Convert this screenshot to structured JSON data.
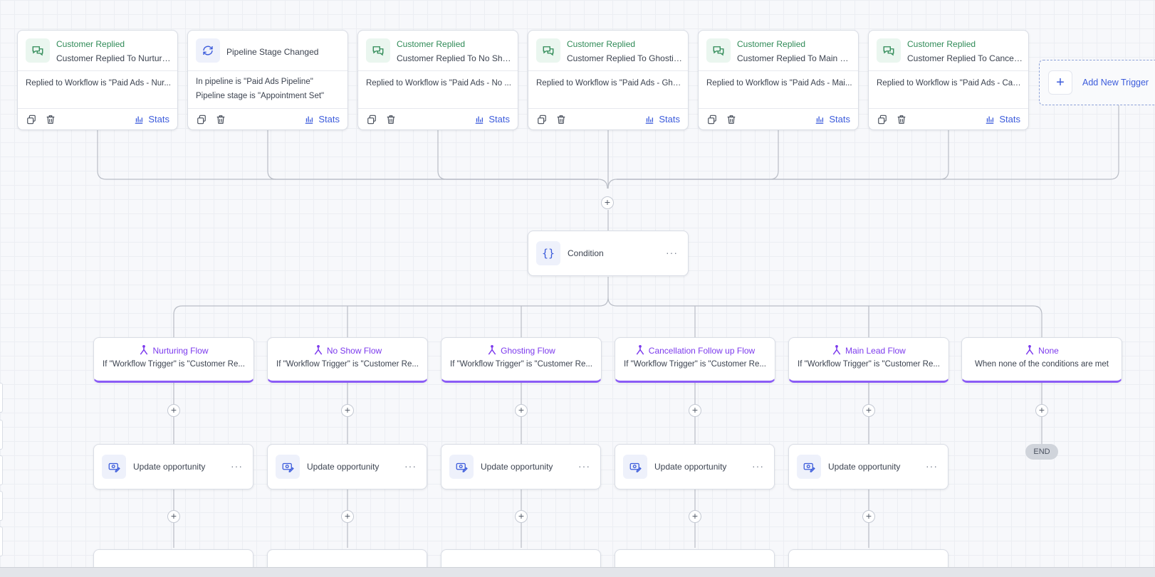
{
  "triggers": [
    {
      "title": "Customer Replied",
      "subtitle": "Customer Replied To Nurturin...",
      "line1": "Replied to Workflow is \"Paid Ads - Nur...",
      "line2": "",
      "icon": "chat-bubbles-icon",
      "stats_label": "Stats"
    },
    {
      "title": "",
      "subtitle": "Pipeline Stage Changed",
      "line1": "In pipeline is \"Paid Ads Pipeline\"",
      "line2": "Pipeline stage is \"Appointment Set\"",
      "icon": "refresh-icon",
      "stats_label": "Stats"
    },
    {
      "title": "Customer Replied",
      "subtitle": "Customer Replied To No Sho...",
      "line1": "Replied to Workflow is \"Paid Ads - No ...",
      "line2": "",
      "icon": "chat-bubbles-icon",
      "stats_label": "Stats"
    },
    {
      "title": "Customer Replied",
      "subtitle": "Customer Replied To Ghostin...",
      "line1": "Replied to Workflow is \"Paid Ads - Gho...",
      "line2": "",
      "icon": "chat-bubbles-icon",
      "stats_label": "Stats"
    },
    {
      "title": "Customer Replied",
      "subtitle": "Customer Replied To Main Le...",
      "line1": "Replied to Workflow is \"Paid Ads - Mai...",
      "line2": "",
      "icon": "chat-bubbles-icon",
      "stats_label": "Stats"
    },
    {
      "title": "Customer Replied",
      "subtitle": "Customer Replied To Cancella...",
      "line1": "Replied to Workflow is \"Paid Ads - Can...",
      "line2": "",
      "icon": "chat-bubbles-icon",
      "stats_label": "Stats"
    }
  ],
  "add_trigger": {
    "label": "Add New Trigger",
    "icon": "plus-icon"
  },
  "condition": {
    "label": "Condition",
    "icon": "braces-icon"
  },
  "branches": [
    {
      "title": "Nurturing Flow",
      "desc": "If \"Workflow Trigger\" is \"Customer Re...",
      "icon": "branch-fork-icon"
    },
    {
      "title": "No Show Flow",
      "desc": "If \"Workflow Trigger\" is \"Customer Re...",
      "icon": "branch-fork-icon"
    },
    {
      "title": "Ghosting Flow",
      "desc": "If \"Workflow Trigger\" is \"Customer Re...",
      "icon": "branch-fork-icon"
    },
    {
      "title": "Cancellation Follow up Flow",
      "desc": "If \"Workflow Trigger\" is \"Customer Re...",
      "icon": "branch-fork-icon"
    },
    {
      "title": "Main Lead Flow",
      "desc": "If \"Workflow Trigger\" is \"Customer Re...",
      "icon": "branch-fork-icon"
    },
    {
      "title": "None",
      "desc": "When none of the conditions are met",
      "icon": "branch-fork-icon"
    }
  ],
  "actions": [
    {
      "label": "Update opportunity",
      "icon": "opportunity-icon"
    },
    {
      "label": "Update opportunity",
      "icon": "opportunity-icon"
    },
    {
      "label": "Update opportunity",
      "icon": "opportunity-icon"
    },
    {
      "label": "Update opportunity",
      "icon": "opportunity-icon"
    },
    {
      "label": "Update opportunity",
      "icon": "opportunity-icon"
    }
  ],
  "end_label": "END",
  "plus_symbol": "+",
  "menu_dots": "···",
  "colors": {
    "accent": "#3b5bdb",
    "trigger_green": "#2f8a57",
    "branch_purple": "#7c3aed",
    "connector": "#b9bdc6"
  }
}
